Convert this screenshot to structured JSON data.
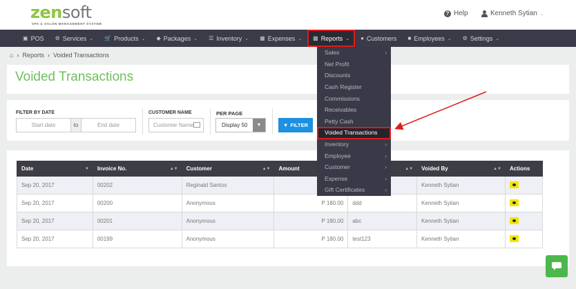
{
  "brand": {
    "logo_zen": "zen",
    "logo_soft": "soft",
    "tagline": "SPA & SALON MANAGEMENT SYSTEM"
  },
  "header": {
    "help_label": "Help",
    "user_name": "Kenneth Sytian"
  },
  "nav": [
    {
      "label": "POS",
      "icon": "pos-icon",
      "caret": false
    },
    {
      "label": "Services",
      "icon": "services-icon",
      "caret": true
    },
    {
      "label": "Products",
      "icon": "cart-icon",
      "caret": true
    },
    {
      "label": "Packages",
      "icon": "tag-icon",
      "caret": true
    },
    {
      "label": "Inventory",
      "icon": "list-icon",
      "caret": true
    },
    {
      "label": "Expenses",
      "icon": "expenses-icon",
      "caret": true
    },
    {
      "label": "Reports",
      "icon": "bar-chart-icon",
      "caret": true,
      "active": true
    },
    {
      "label": "Customers",
      "icon": "users-icon",
      "caret": false
    },
    {
      "label": "Employees",
      "icon": "briefcase-icon",
      "caret": true
    },
    {
      "label": "Settings",
      "icon": "gear-icon",
      "caret": true
    }
  ],
  "breadcrumb": {
    "items": [
      "Reports",
      "Voided Transactions"
    ]
  },
  "page": {
    "title": "Voided Transactions"
  },
  "filters": {
    "by_date_label": "FILTER BY DATE",
    "start_placeholder": "Start date",
    "to_label": "to",
    "end_placeholder": "End date",
    "customer_label": "CUSTOMER NAME",
    "customer_placeholder": "Customer Name",
    "per_page_label": "PER PAGE",
    "per_page_value": "Display 50",
    "filter_button": "FILTER"
  },
  "reports_menu": [
    {
      "label": "Sales",
      "submenu": true
    },
    {
      "label": "Net Profit",
      "submenu": false
    },
    {
      "label": "Discounts",
      "submenu": false
    },
    {
      "label": "Cash Register",
      "submenu": false
    },
    {
      "label": "Commissions",
      "submenu": false
    },
    {
      "label": "Receivables",
      "submenu": false
    },
    {
      "label": "Petty Cash",
      "submenu": false
    },
    {
      "label": "Voided Transactions",
      "submenu": false,
      "highlighted": true
    },
    {
      "label": "Inventory",
      "submenu": true
    },
    {
      "label": "Employee",
      "submenu": true
    },
    {
      "label": "Customer",
      "submenu": true
    },
    {
      "label": "Expense",
      "submenu": true
    },
    {
      "label": "Gift Certificates",
      "submenu": true
    }
  ],
  "table": {
    "headers": [
      "Date",
      "Invoice No.",
      "Customer",
      "Amount",
      "",
      "Voided By",
      "Actions"
    ],
    "rows": [
      {
        "date": "Sep 20, 2017",
        "invoice": "00202",
        "customer": "Reginald Santos",
        "amount": "",
        "reason": "",
        "voided_by": "Kenneth Sytian"
      },
      {
        "date": "Sep 20, 2017",
        "invoice": "00200",
        "customer": "Anonymous",
        "amount": "P 180.00",
        "reason": "ddd",
        "voided_by": "Kenneth Sytian"
      },
      {
        "date": "Sep 20, 2017",
        "invoice": "00201",
        "customer": "Anonymous",
        "amount": "P 180.00",
        "reason": "abc",
        "voided_by": "Kenneth Sytian"
      },
      {
        "date": "Sep 20, 2017",
        "invoice": "00199",
        "customer": "Anonymous",
        "amount": "P 180.00",
        "reason": "test123",
        "voided_by": "Kenneth Sytian"
      }
    ]
  },
  "colors": {
    "accent_green": "#6fbf5f",
    "nav_bg": "#3a3a48",
    "filter_blue": "#1e90e0",
    "annotation_red": "#e01b1b",
    "action_yellow": "#f2e600"
  }
}
